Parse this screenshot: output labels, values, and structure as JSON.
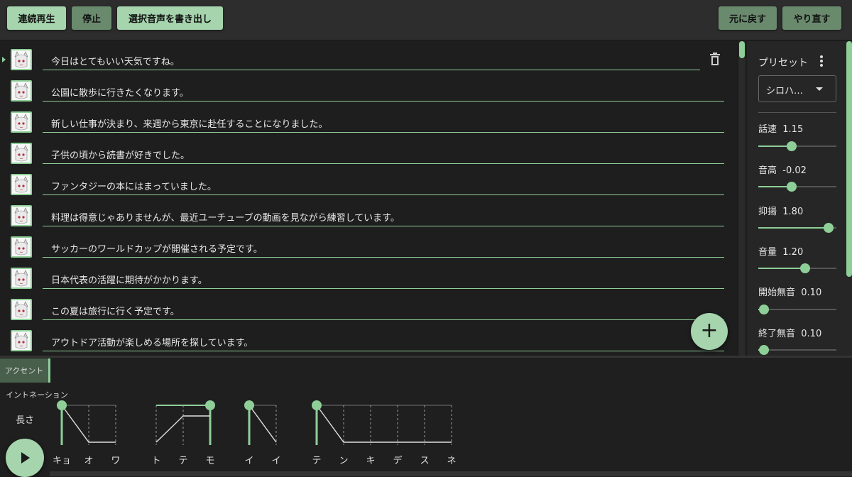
{
  "toolbar": {
    "continuous_play": "連続再生",
    "stop": "停止",
    "export_selected": "選択音声を書き出し",
    "undo": "元に戻す",
    "redo": "やり直す"
  },
  "sentences": [
    "今日はとてもいい天気ですね。",
    "公園に散歩に行きたくなります。",
    "新しい仕事が決まり、来週から東京に赴任することになりました。",
    "子供の頃から読書が好きでした。",
    "ファンタジーの本にはまっていました。",
    "料理は得意じゃありませんが、最近ユーチューブの動画を見ながら練習しています。",
    "サッカーのワールドカップが開催される予定です。",
    "日本代表の活躍に期待がかかります。",
    "この夏は旅行に行く予定です。",
    "アウトドア活動が楽しめる場所を探しています。"
  ],
  "add_button": "+",
  "side": {
    "preset_title": "プリセット",
    "preset_value": "シロハ…",
    "params": [
      {
        "name": "話速",
        "value": "1.15",
        "level": 0.43
      },
      {
        "name": "音高",
        "value": "-0.02",
        "level": 0.43
      },
      {
        "name": "抑揚",
        "value": "1.80",
        "level": 0.9
      },
      {
        "name": "音量",
        "value": "1.20",
        "level": 0.6
      },
      {
        "name": "開始無音",
        "value": "0.10",
        "level": 0.07
      },
      {
        "name": "終了無音",
        "value": "0.10",
        "level": 0.07
      }
    ]
  },
  "bottom": {
    "tabs": [
      "アクセント",
      "イントネーション",
      "長さ"
    ],
    "accent_phrases": [
      {
        "moras": [
          "キョ",
          "オ",
          "ワ"
        ],
        "accent": 1
      },
      {
        "moras": [
          "ト",
          "テ",
          "モ"
        ],
        "accent": 3
      },
      {
        "moras": [
          "イ",
          "イ"
        ],
        "accent": 1
      },
      {
        "moras": [
          "テ",
          "ン",
          "キ",
          "デ",
          "ス",
          "ネ"
        ],
        "accent": 1
      }
    ]
  },
  "colors": {
    "accent": "#8ecf98",
    "button": "#a5d4ad",
    "background": "#1e1e1e"
  }
}
